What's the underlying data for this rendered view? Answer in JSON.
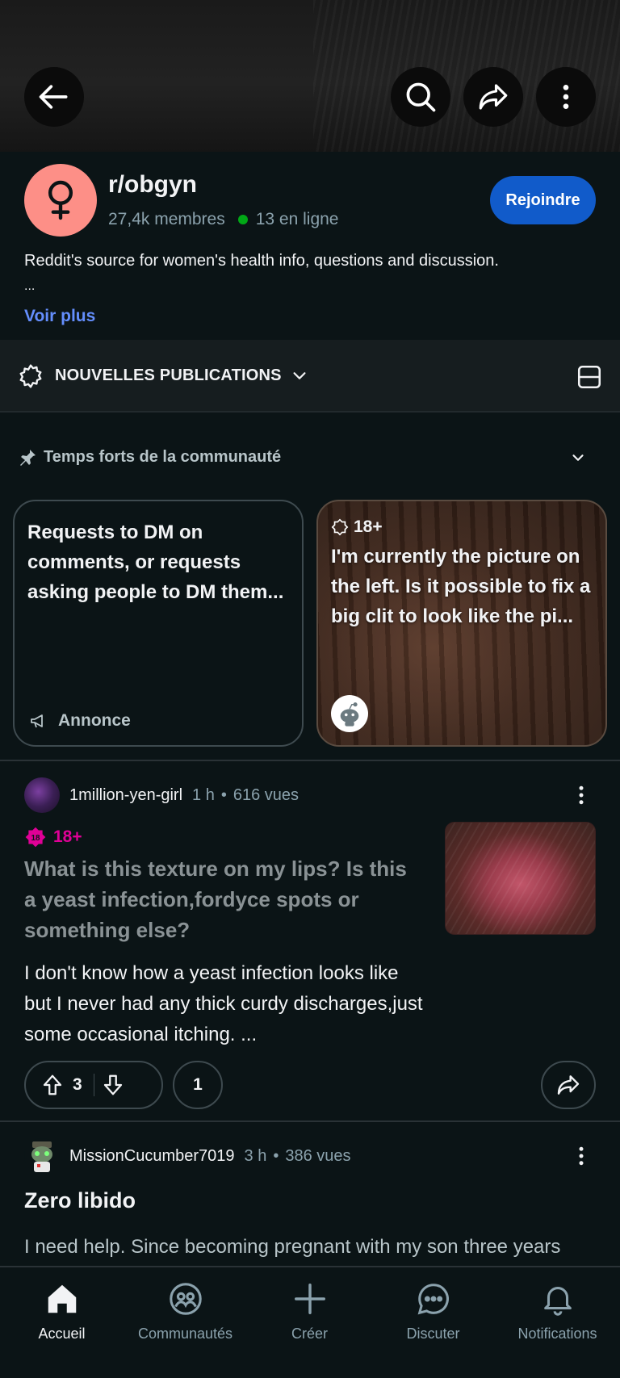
{
  "topbar": {
    "back_icon": "arrow-left-icon",
    "search_icon": "search-icon",
    "share_icon": "share-icon",
    "more_icon": "more-vertical-icon"
  },
  "community": {
    "name": "r/obgyn",
    "members": "27,4k membres",
    "online": "13 en ligne",
    "join_label": "Rejoindre",
    "description": "Reddit's source for women's health info, questions and discussion.",
    "description_ellipsis": "...",
    "see_more": "Voir plus",
    "avatar_color": "#fd8f87",
    "icon": "female-symbol-icon"
  },
  "sort": {
    "label": "NOUVELLES PUBLICATIONS",
    "icon": "new-sort-icon"
  },
  "highlights": {
    "title": "Temps forts de la communauté",
    "cards": [
      {
        "text": "Requests to DM on comments, or requests asking people to DM them...",
        "footer": "Annonce"
      },
      {
        "badge": "18+",
        "text": "I'm currently the picture on the left. Is it possible to fix a big clit to look like the pi..."
      }
    ]
  },
  "posts": [
    {
      "author": "1million-yen-girl",
      "time": "1 h",
      "views": "616 vues",
      "badge": "18+",
      "title": "What is this texture on my lips? Is this a yeast infection,fordyce spots or something else?",
      "body": "I don't know how a yeast infection looks like but I never had any thick curdy discharges,just some occasional itching. ...",
      "upvotes": "3",
      "comments": "1"
    },
    {
      "author": "MissionCucumber7019",
      "time": "3 h",
      "views": "386 vues",
      "title": "Zero libido",
      "body": "I need help. Since becoming pregnant with my son three years"
    }
  ],
  "nav": {
    "items": [
      {
        "label": "Accueil",
        "icon": "home-icon"
      },
      {
        "label": "Communautés",
        "icon": "communities-icon"
      },
      {
        "label": "Créer",
        "icon": "plus-icon"
      },
      {
        "label": "Discuter",
        "icon": "chat-icon"
      },
      {
        "label": "Notifications",
        "icon": "bell-icon"
      }
    ]
  },
  "colors": {
    "background": "#0b1416",
    "join_button": "#115bca",
    "link": "#648efc",
    "nsfw": "#e00096",
    "online": "#01a816"
  }
}
